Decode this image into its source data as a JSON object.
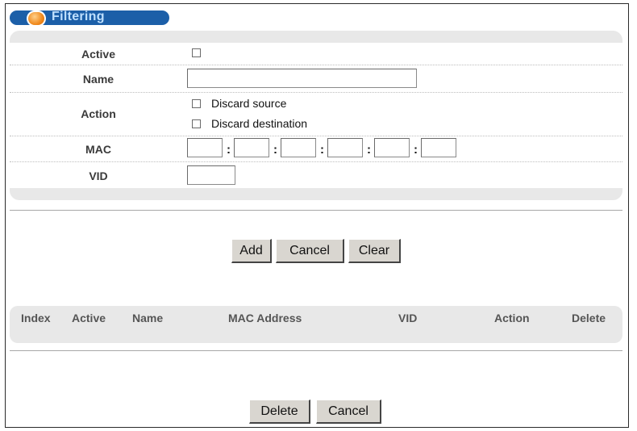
{
  "header": {
    "title": "Filtering"
  },
  "form": {
    "active_label": "Active",
    "name_label": "Name",
    "name_value": "",
    "action_label": "Action",
    "discard_source_label": "Discard source",
    "discard_destination_label": "Discard destination",
    "mac_label": "MAC",
    "mac_values": [
      "",
      "",
      "",
      "",
      "",
      ""
    ],
    "mac_separator": ":",
    "vid_label": "VID",
    "vid_value": ""
  },
  "buttons": {
    "add": "Add",
    "cancel": "Cancel",
    "clear": "Clear",
    "delete": "Delete",
    "cancel2": "Cancel"
  },
  "table": {
    "columns": [
      "Index",
      "Active",
      "Name",
      "MAC Address",
      "VID",
      "Action",
      "Delete"
    ]
  },
  "colors": {
    "title_pill": "#1c5fa8",
    "title_text": "#bfe0ff",
    "panel_bg": "#e8e8e8",
    "button_face": "#d9d6d0"
  }
}
